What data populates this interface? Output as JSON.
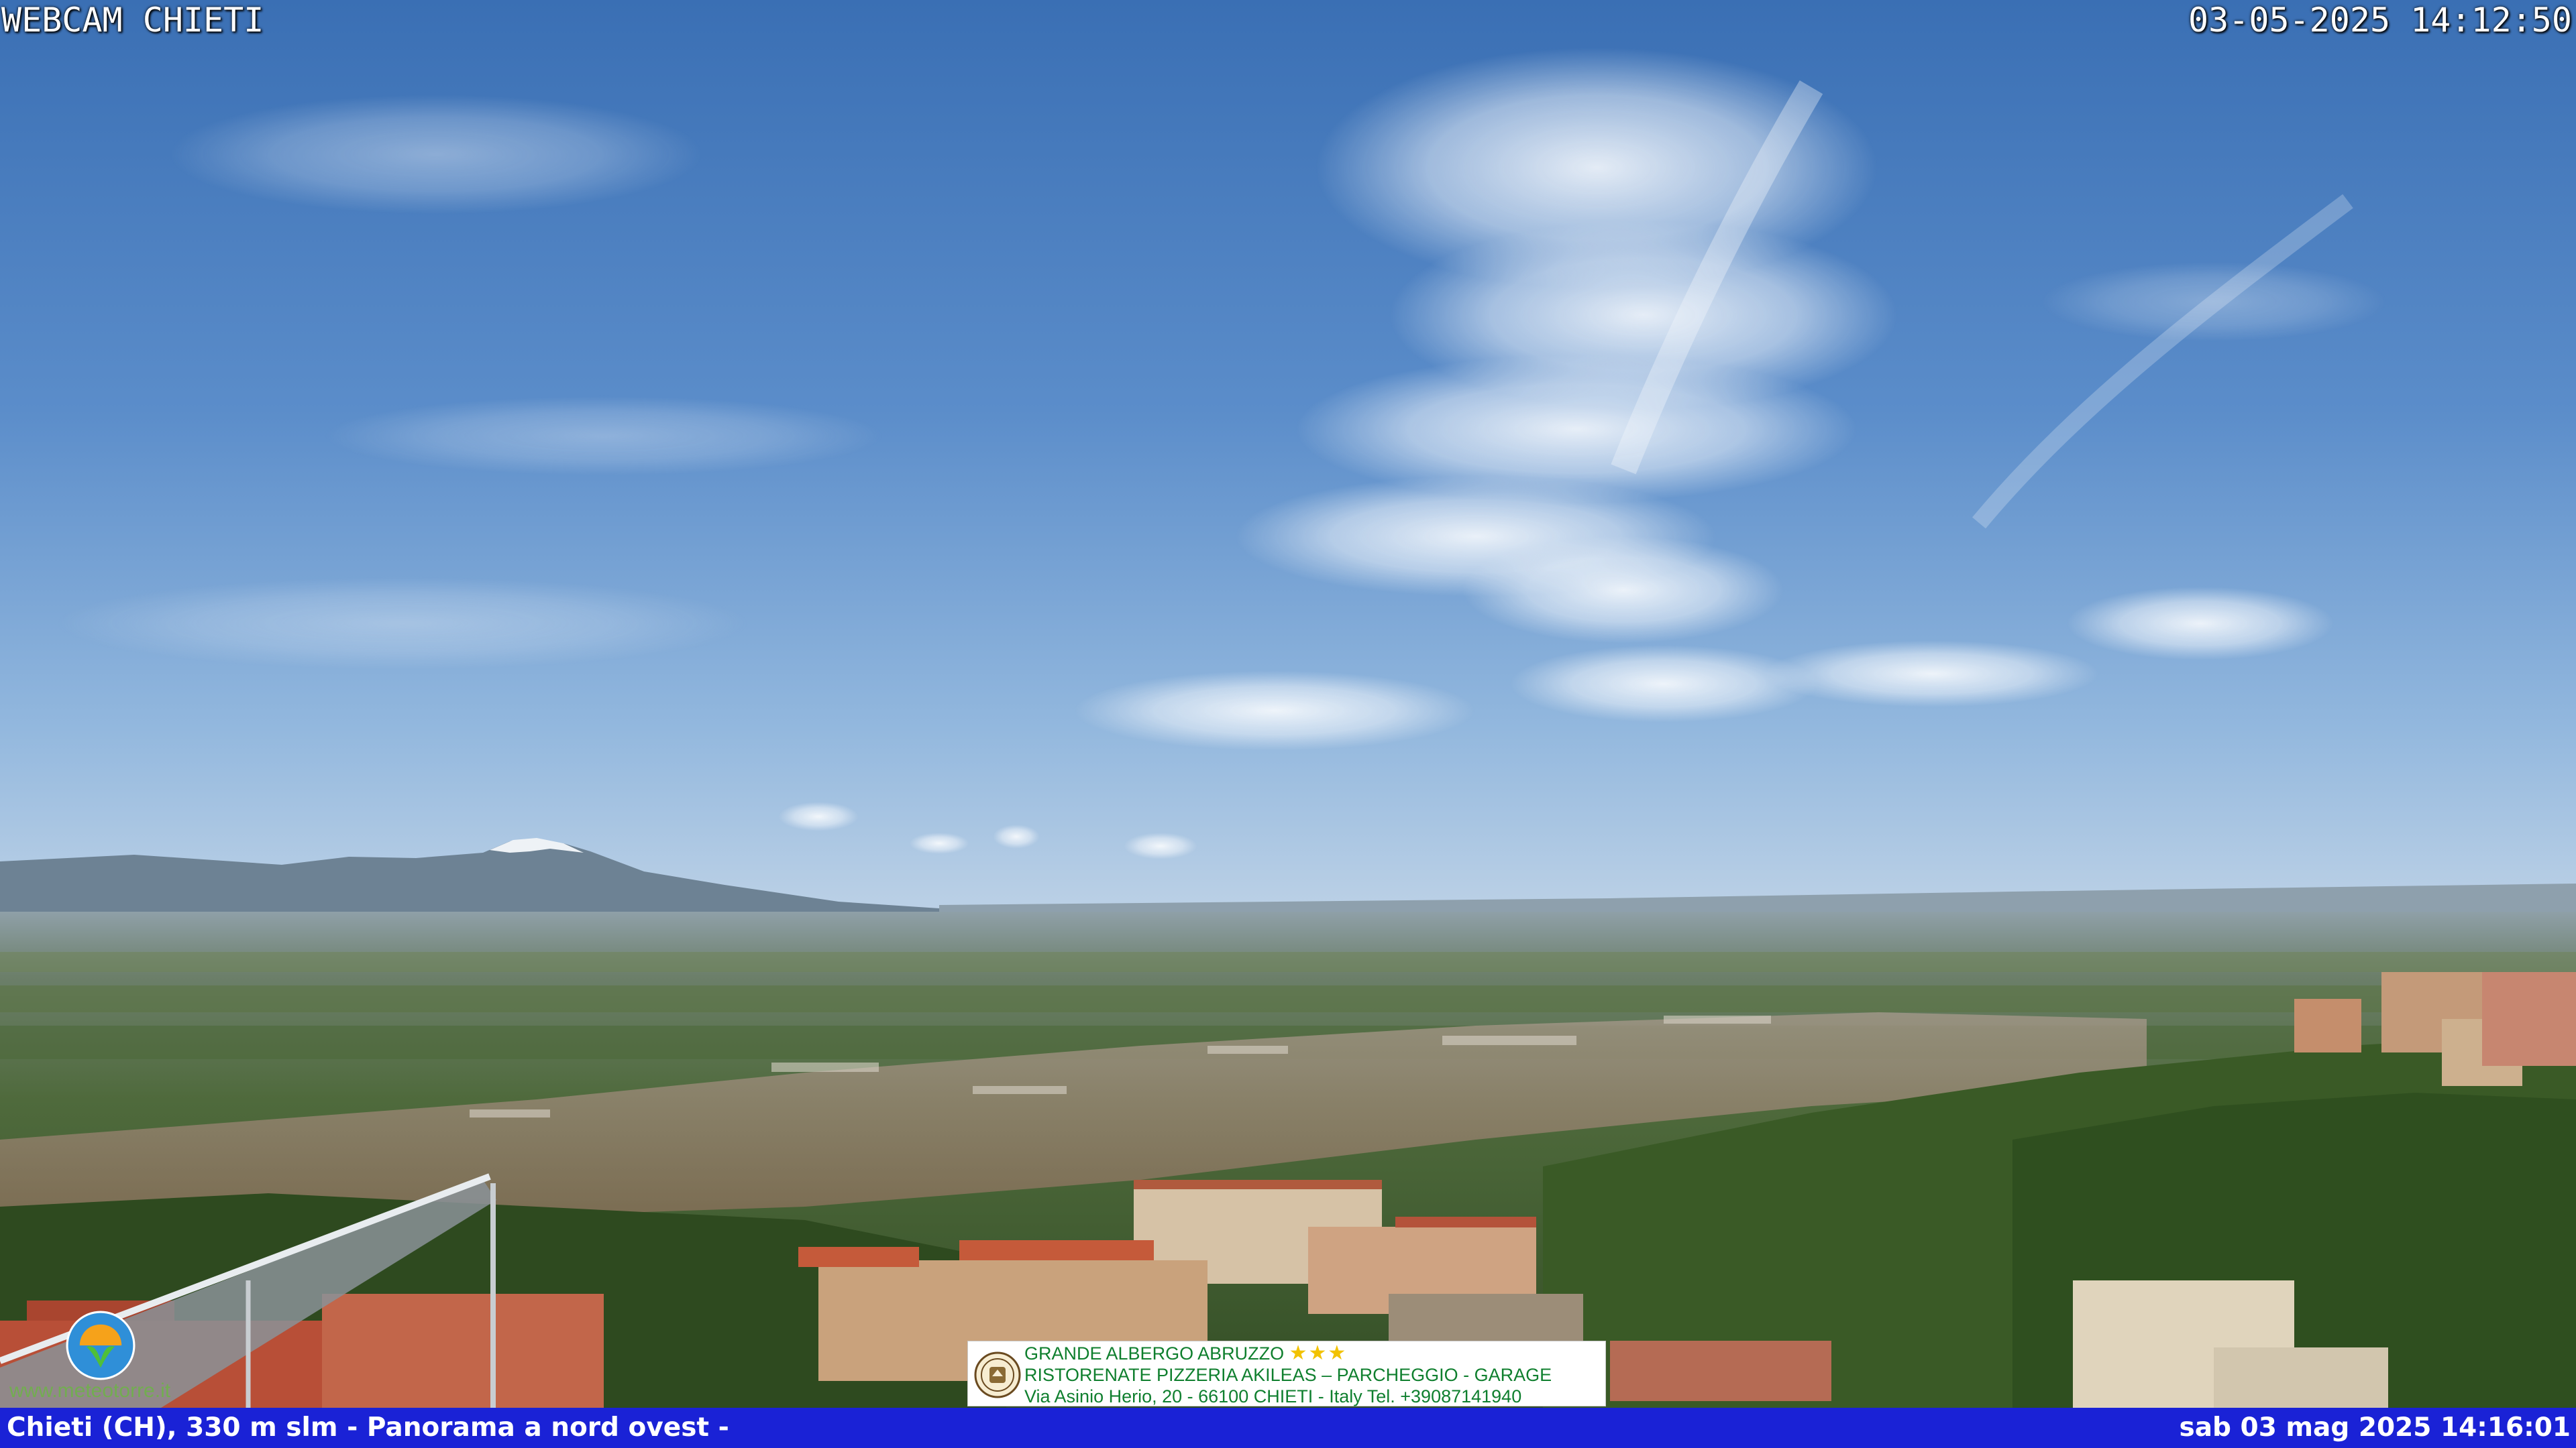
{
  "overlay": {
    "title": "WEBCAM CHIETI",
    "timestamp": "03-05-2025 14:12:50"
  },
  "footer": {
    "location": "Chieti (CH), 330 m slm - Panorama a nord ovest -",
    "datetime": "sab 03 mag 2025 14:16:01",
    "background": "#1a22d6"
  },
  "ad": {
    "line1": "GRANDE ALBERGO ABRUZZO",
    "stars": "★★★",
    "line2": "RISTORENATE PIZZERIA AKILEAS – PARCHEGGIO - GARAGE",
    "line3": "Via Asinio Herio, 20 - 66100 CHIETI - Italy Tel. +39087141940"
  },
  "logo": {
    "icon": "meteotorre-logo-icon",
    "url": "www.meteotorre.it"
  },
  "colors": {
    "sky_top": "#3c72b6",
    "sky_horizon": "#a9c6e3",
    "haze": "#b8cad6",
    "vegetation": "#3f5a2a",
    "roofs": "#b8563a",
    "ad_text": "#0f7f2e",
    "stars": "#f2c200"
  }
}
